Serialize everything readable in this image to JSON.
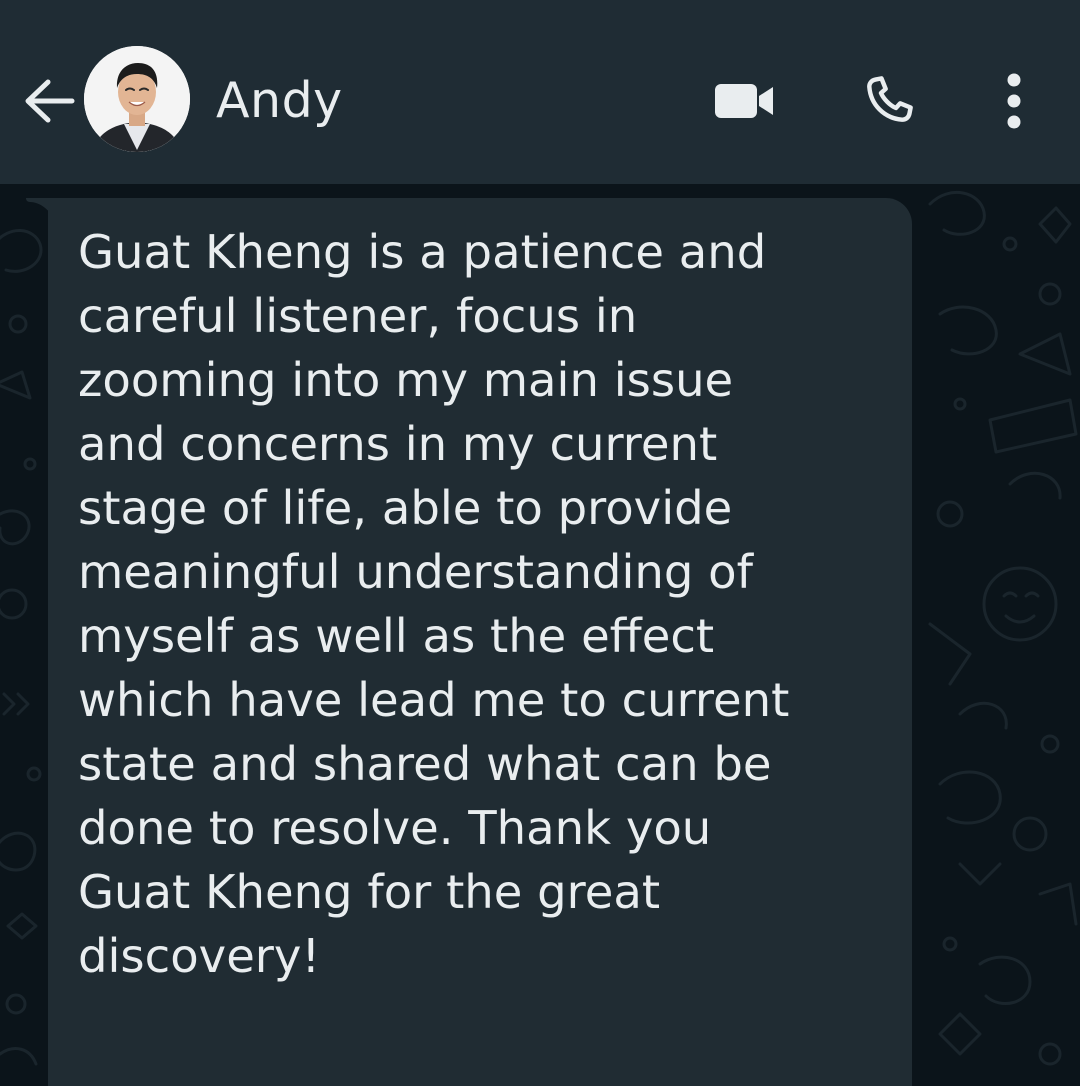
{
  "header": {
    "contact_name": "Andy",
    "icons": {
      "back": "arrow-back-icon",
      "avatar": "profile-photo",
      "video": "video-camera-icon",
      "call": "phone-icon",
      "menu": "more-vertical-icon"
    }
  },
  "message": {
    "direction": "incoming",
    "text": "Guat Kheng is a patience and\ncareful listener, focus in\nzooming into my main issue\nand concerns in my current\nstage of life, able to provide\nmeaningful understanding of\nmyself as well as the effect\nwhich have lead me to current\nstate and shared what can be\ndone to resolve.  Thank you\nGuat Kheng for the great\ndiscovery!"
  },
  "colors": {
    "header_bg": "#1f2c34",
    "wallpaper_bg": "#0b141a",
    "bubble_bg": "#202c33",
    "text": "#e9edef"
  }
}
